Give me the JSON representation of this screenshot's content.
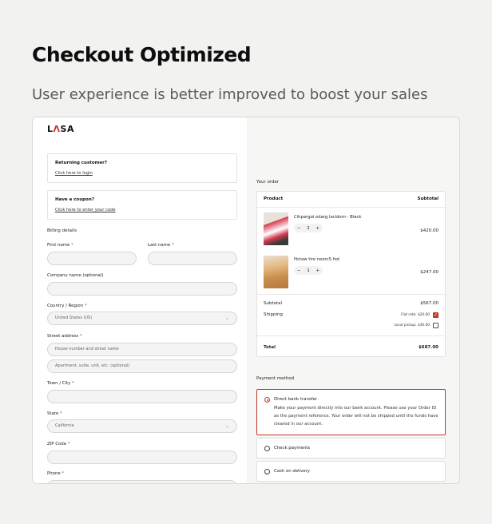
{
  "hero": {
    "title": "Checkout Optimized",
    "subtitle": "User experience is better improved to boost your sales"
  },
  "brand": {
    "logo_a": "L",
    "logo_accent": "Λ",
    "logo_b": "SA",
    "accent_color": "#c0392b"
  },
  "returning": {
    "title": "Returning customer?",
    "link": "Click here to login"
  },
  "coupon": {
    "title": "Have a coupon?",
    "link": "Click here to enter your code"
  },
  "billing": {
    "heading": "Billing details",
    "first_name": "First name",
    "last_name": "Last name",
    "company": "Company name (optional)",
    "country": "Country / Region",
    "country_value": "United States (US)",
    "street": "Street address",
    "street_ph1": "House number and street name",
    "street_ph2": "Apartment, suite, unit, etc. (optional)",
    "town": "Town / City",
    "state": "State",
    "state_value": "California",
    "zip": "ZIP Code",
    "phone": "Phone",
    "required_mark": "*"
  },
  "order": {
    "heading": "Your order",
    "col_product": "Product",
    "col_subtotal": "Subtotal",
    "items": [
      {
        "name": "Cihpargoi edarg lacidem - Black",
        "qty": "2",
        "price": "$420.00"
      },
      {
        "name": "Hctaw tire neercS hot",
        "qty": "1",
        "price": "$247.00"
      }
    ],
    "qty_minus": "−",
    "qty_plus": "+",
    "subtotal_label": "Subtotal",
    "subtotal_value": "$567.00",
    "shipping_label": "Shipping",
    "ship_flat": "Flat rate: $20.00",
    "ship_local": "Local pickup: $30.00",
    "total_label": "Total",
    "total_value": "$687.00"
  },
  "payment": {
    "heading": "Payment method",
    "options": [
      {
        "label": "Direct bank transfer",
        "selected": true
      },
      {
        "label": "Check payments",
        "selected": false
      },
      {
        "label": "Cash on delivery",
        "selected": false
      }
    ],
    "bank_desc": "Make your payment directly into our bank account. Please use your Order ID as the payment reference. Your order will not be shipped until the funds have cleared in our account."
  }
}
